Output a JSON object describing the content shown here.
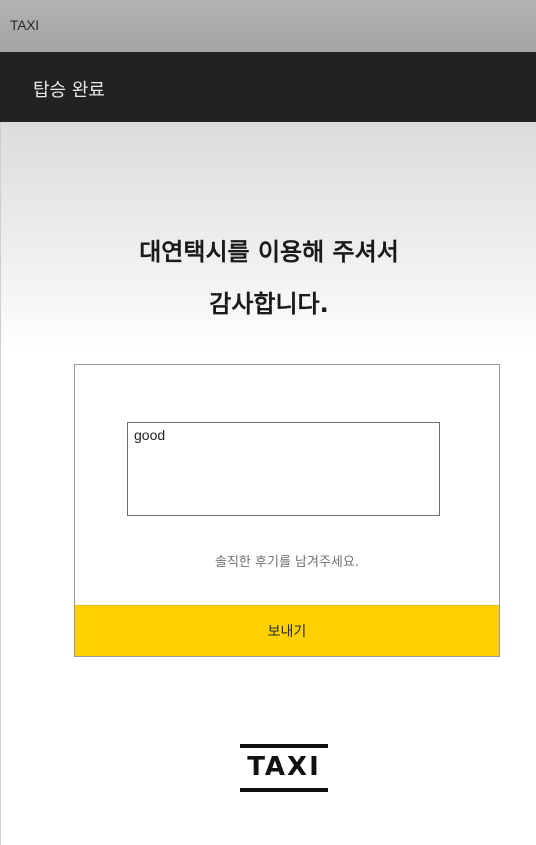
{
  "window": {
    "title": "TAXI"
  },
  "header": {
    "title": "탑승 완료"
  },
  "main": {
    "thanks_line1": "대연택시를 이용해 주셔서",
    "thanks_line2": "감사합니다.",
    "review": {
      "value": "good",
      "hint": "솔직한 후기를 남겨주세요."
    },
    "send_label": "보내기"
  },
  "logo": {
    "text": "TAXI"
  },
  "colors": {
    "header_bg": "#222222",
    "accent": "#fdd200",
    "titlebar_bg": "#aaaaaa"
  }
}
